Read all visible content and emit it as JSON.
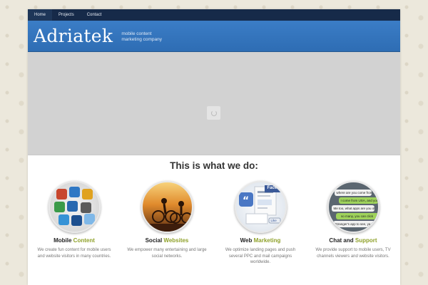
{
  "nav": {
    "items": [
      {
        "label": "Home"
      },
      {
        "label": "Projects"
      },
      {
        "label": "Contact"
      }
    ]
  },
  "header": {
    "logo": "Adriatek",
    "tagline_line1": "mobile content",
    "tagline_line2": "marketing company"
  },
  "main": {
    "section_title": "This is what we do:"
  },
  "services": [
    {
      "title_a": "Mobile",
      "title_b": "Content",
      "desc": "We create fun content for mobile users and website visitors in many countries."
    },
    {
      "title_a": "Social",
      "title_b": "Websites",
      "desc": "We empower many entertaining and large social networks."
    },
    {
      "title_a": "Web",
      "title_b": "Marketing",
      "desc": "We optimize landing pages and push several PPC and mail campaigns worldwide."
    },
    {
      "title_a": "Chat and",
      "title_b": "Support",
      "desc": "We provide support to mobile users, TV channels viewers and website visitors."
    }
  ],
  "chat_bubbles": [
    "where are you come from",
    "I come from USA, and you",
    "Me too, what apps are you often using?",
    "so many, you can click",
    "Stranger's app to see, ya ya"
  ],
  "web_labels": {
    "face": "Face",
    "like": "Like"
  },
  "colors": {
    "nav_bg": "#162a49",
    "header_bg": "#2e6db4",
    "accent": "#8fa12a"
  }
}
